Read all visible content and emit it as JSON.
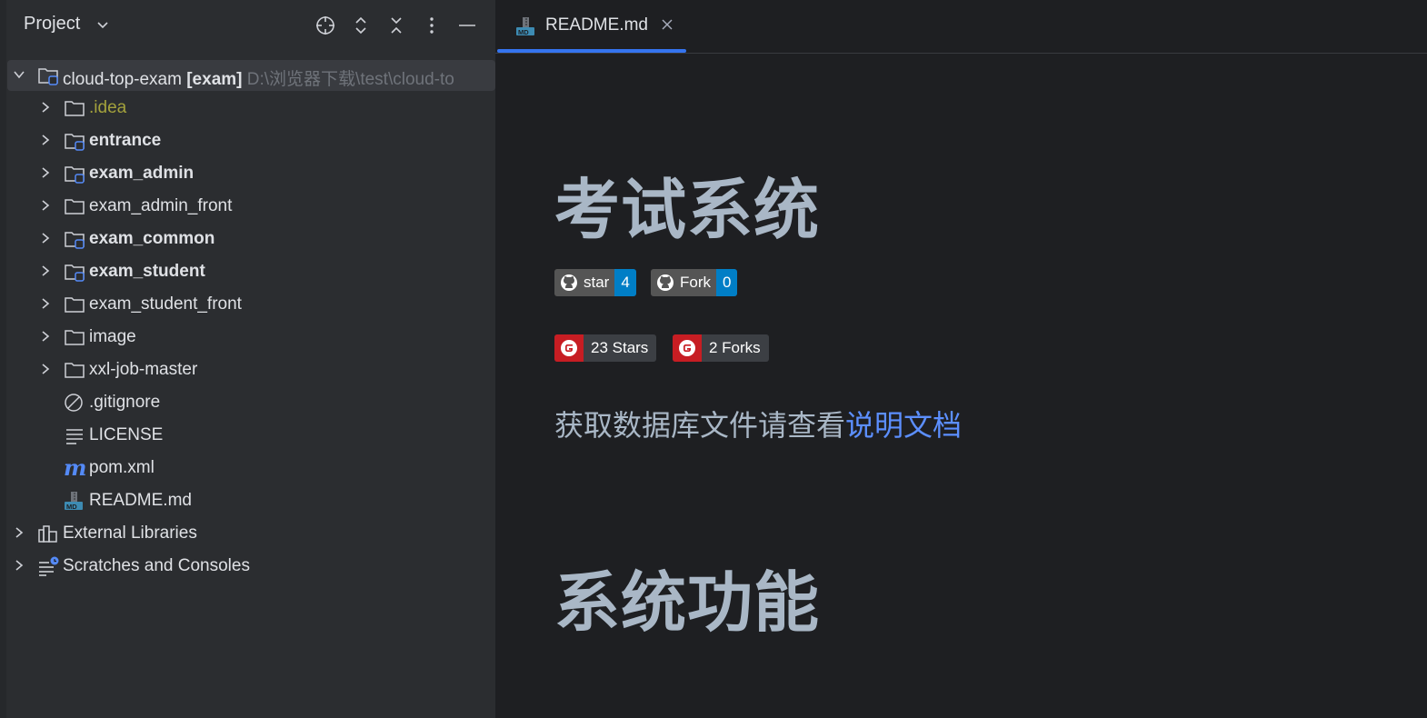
{
  "project_panel": {
    "title": "Project",
    "tree": [
      {
        "label": "cloud-top-exam",
        "module": "[exam]",
        "path": "D:\\浏览器下载\\test\\cloud-to",
        "expanded": true,
        "selected": true,
        "icon": "module-folder-icon"
      },
      {
        "label": ".idea",
        "icon": "folder-icon"
      },
      {
        "label": "entrance",
        "icon": "module-folder-icon"
      },
      {
        "label": "exam_admin",
        "icon": "module-folder-icon"
      },
      {
        "label": "exam_admin_front",
        "icon": "folder-icon"
      },
      {
        "label": "exam_common",
        "icon": "module-folder-icon"
      },
      {
        "label": "exam_student",
        "icon": "module-folder-icon"
      },
      {
        "label": "exam_student_front",
        "icon": "folder-icon"
      },
      {
        "label": "image",
        "icon": "folder-icon"
      },
      {
        "label": "xxl-job-master",
        "icon": "folder-icon"
      },
      {
        "label": ".gitignore",
        "icon": "ignore-file-icon"
      },
      {
        "label": "LICENSE",
        "icon": "text-file-icon"
      },
      {
        "label": "pom.xml",
        "icon": "maven-icon"
      },
      {
        "label": "README.md",
        "icon": "markdown-icon"
      },
      {
        "label": "External Libraries",
        "icon": "library-icon"
      },
      {
        "label": "Scratches and Consoles",
        "icon": "scratches-icon"
      }
    ]
  },
  "editor": {
    "tab_label": "README.md",
    "heading1": "考试系统",
    "github_badges": [
      {
        "label": "star",
        "count": "4"
      },
      {
        "label": "Fork",
        "count": "0"
      }
    ],
    "gitee_badges": [
      {
        "label": "23 Stars"
      },
      {
        "label": "2 Forks"
      }
    ],
    "paragraph_text": "获取数据库文件请查看",
    "paragraph_link": "说明文档",
    "heading2": "系统功能"
  },
  "colors": {
    "accent": "#3574f0",
    "link": "#5c8fff",
    "heading": "#a9b7c6",
    "gitee_red": "#c71d23",
    "badge_blue": "#007ec6"
  }
}
